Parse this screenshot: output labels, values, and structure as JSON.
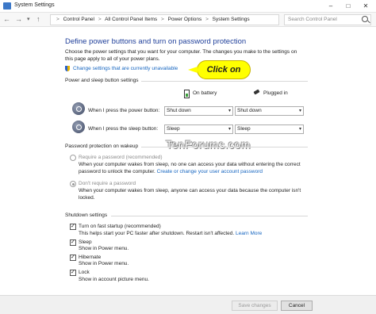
{
  "window": {
    "title": "System Settings",
    "minimize": "–",
    "maximize": "□",
    "close": "✕"
  },
  "nav": {
    "back": "←",
    "forward": "→",
    "up": "↑"
  },
  "breadcrumb": [
    "Control Panel",
    "All Control Panel Items",
    "Power Options",
    "System Settings"
  ],
  "breadcrumb_sep": ">",
  "search": {
    "placeholder": "Search Control Panel"
  },
  "page": {
    "heading": "Define power buttons and turn on password protection",
    "intro": "Choose the power settings that you want for your computer. The changes you make to the settings on this page apply to all of your power plans.",
    "change_link": "Change settings that are currently unavailable",
    "callout": "Click on"
  },
  "power_section": {
    "title": "Power and sleep button settings",
    "col_battery": "On battery",
    "col_plugged": "Plugged in",
    "rows": [
      {
        "label": "When I press the power button:",
        "battery": "Shut down",
        "plugged": "Shut down"
      },
      {
        "label": "When I press the sleep button:",
        "battery": "Sleep",
        "plugged": "Sleep"
      }
    ]
  },
  "watermark": "TenForums.com",
  "password_section": {
    "title": "Password protection on wakeup",
    "require_label": "Require a password (recommended)",
    "require_desc": "When your computer wakes from sleep, no one can access your data without entering the correct password to unlock the computer.",
    "require_link": "Create or change your user account password",
    "dont_label": "Don't require a password",
    "dont_desc": "When your computer wakes from sleep, anyone can access your data because the computer isn't locked."
  },
  "shutdown_section": {
    "title": "Shutdown settings",
    "items": [
      {
        "label": "Turn on fast startup (recommended)",
        "desc": "This helps start your PC faster after shutdown. Restart isn't affected.",
        "link": "Learn More"
      },
      {
        "label": "Sleep",
        "desc": "Show in Power menu."
      },
      {
        "label": "Hibernate",
        "desc": "Show in Power menu."
      },
      {
        "label": "Lock",
        "desc": "Show in account picture menu."
      }
    ]
  },
  "buttons": {
    "save": "Save changes",
    "cancel": "Cancel"
  }
}
